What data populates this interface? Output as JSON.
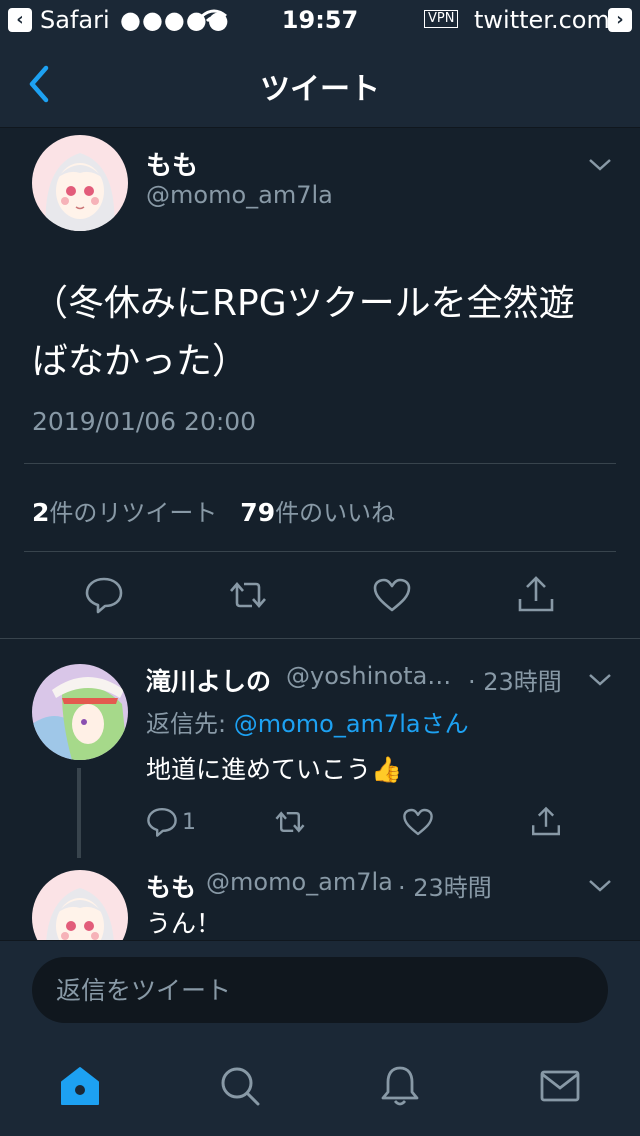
{
  "status_bar": {
    "app": "Safari",
    "signal": "●●●●●",
    "time": "19:57",
    "vpn": "VPN",
    "domain": "twitter.com"
  },
  "nav": {
    "title": "ツイート"
  },
  "tweet": {
    "name": "もも",
    "handle": "@momo_am7la",
    "text": "（冬休みにRPGツクールを全然遊ばなかった）",
    "date": "2019/01/06 20:00",
    "retweet_count": "2",
    "retweet_label": "件のリツイート",
    "like_count": "79",
    "like_label": "件のいいね"
  },
  "replies": [
    {
      "name": "滝川よしの",
      "handle": "@yoshinota…",
      "time": "· 23時間",
      "reply_to_label": "返信先: ",
      "reply_to": "@momo_am7laさん",
      "text": "地道に進めていこう👍",
      "reply_count": "1"
    },
    {
      "name": "もも",
      "handle": "@momo_am7la",
      "time": "· 23時間",
      "text": "うん！"
    }
  ],
  "compose": {
    "placeholder": "返信をツイート"
  },
  "colors": {
    "accent": "#1da1f2",
    "background": "#15202b",
    "bar": "#1b2836",
    "muted": "#8899a6"
  }
}
